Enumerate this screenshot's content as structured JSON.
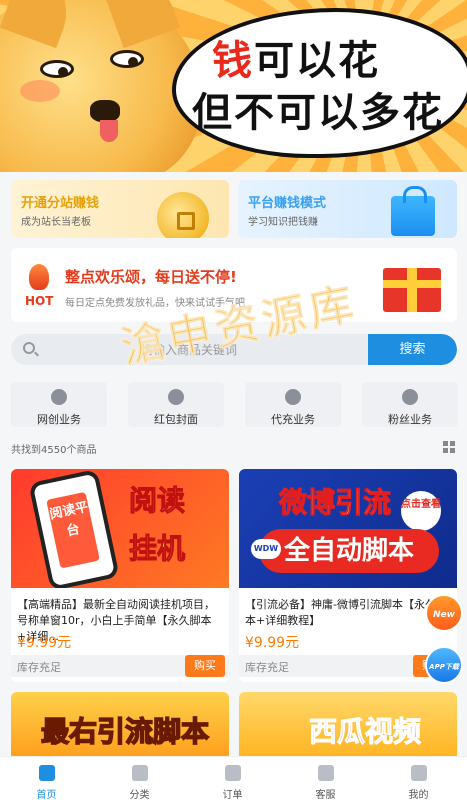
{
  "banner": {
    "line1_red": "钱",
    "line1_rest": "可以花",
    "line2": "但不可以多花"
  },
  "promos": {
    "left": {
      "title": "开通分站赚钱",
      "subtitle": "成为站长当老板"
    },
    "right": {
      "title": "平台赚钱模式",
      "subtitle": "学习知识把钱赚"
    }
  },
  "hot": {
    "label": "HOT",
    "title": "整点欢乐颂，每日送不停!",
    "subtitle": "每日定点免费发放礼品，快来试试手气吧"
  },
  "watermark": "滄申资源库",
  "search": {
    "placeholder": "请输入商品关键词",
    "button": "搜索"
  },
  "categories": [
    {
      "label": "网创业务",
      "icon": "globe-icon"
    },
    {
      "label": "红包封面",
      "icon": "tag-icon"
    },
    {
      "label": "代充业务",
      "icon": "crown-icon"
    },
    {
      "label": "粉丝业务",
      "icon": "user-icon"
    }
  ],
  "result_count": "共找到4550个商品",
  "products": [
    {
      "thumb_line1": "阅读",
      "thumb_line2": "挂机",
      "thumb_phone_text": "阅读平台",
      "title": "【高端精品】最新全自动阅读挂机项目，号称单窗10r，小白上手简单【永久脚本+详细...",
      "price": "¥9.99元",
      "stock": "库存充足",
      "buy": "购买"
    },
    {
      "thumb_line1": "微博引流",
      "thumb_line2": "全自动脚本",
      "thumb_badge": "点击查看",
      "thumb_tag": "WDW",
      "title": "【引流必备】神庸-微博引流脚本【永久脚本+详细教程】",
      "price": "¥9.99元",
      "stock": "库存充足",
      "buy": "购买"
    }
  ],
  "products_more": [
    {
      "thumb_text": "最右引流脚本"
    },
    {
      "thumb_text": "西瓜视频"
    }
  ],
  "floats": {
    "new": "New",
    "app": "APP下载"
  },
  "nav": [
    {
      "label": "首页",
      "icon": "home-icon",
      "active": true
    },
    {
      "label": "分类",
      "icon": "grid-icon",
      "active": false
    },
    {
      "label": "订单",
      "icon": "order-icon",
      "active": false
    },
    {
      "label": "客服",
      "icon": "headset-icon",
      "active": false
    },
    {
      "label": "我的",
      "icon": "profile-icon",
      "active": false
    }
  ],
  "colors": {
    "accent": "#1e8fe0",
    "price": "#ff7a00",
    "hot": "#e53b1d"
  }
}
